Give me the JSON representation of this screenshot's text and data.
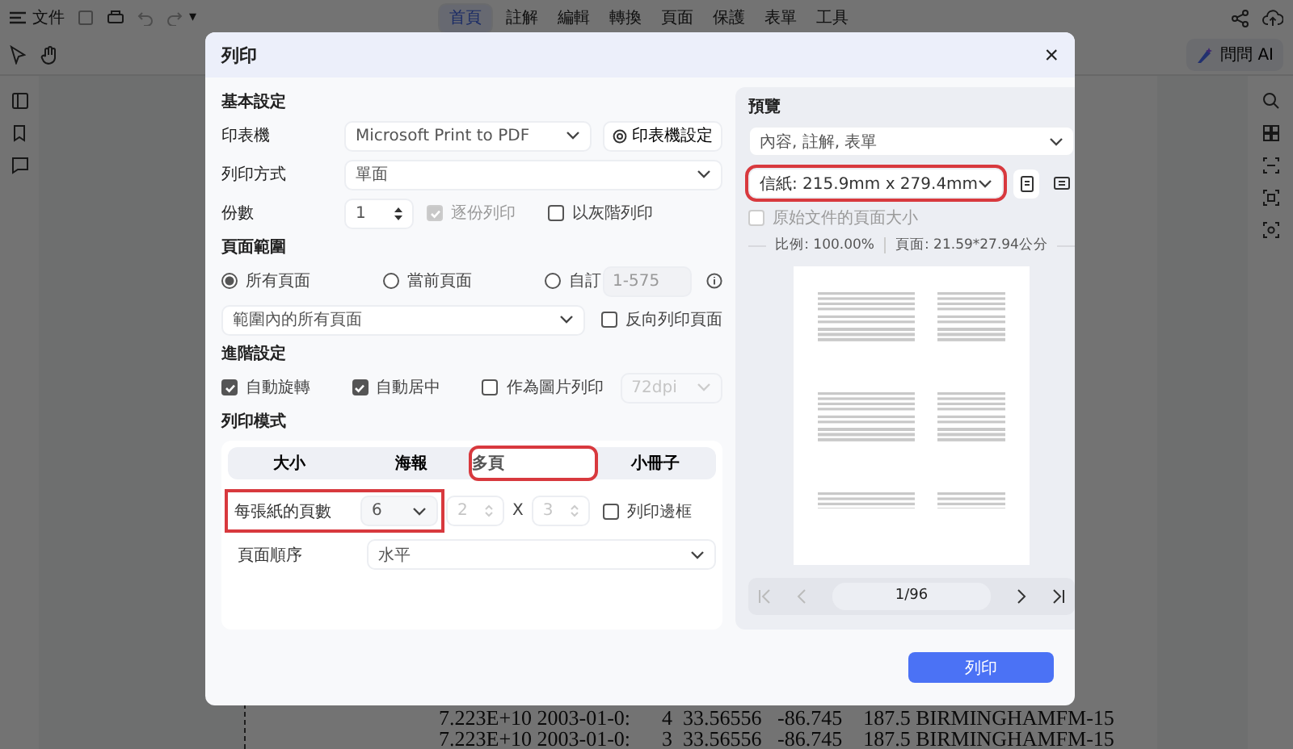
{
  "toolbar": {
    "file_menu": "文件",
    "more": "▾",
    "tabs": [
      {
        "label": "首頁",
        "selected": true
      },
      {
        "label": "註解",
        "selected": false
      },
      {
        "label": "編輯",
        "selected": false
      },
      {
        "label": "轉換",
        "selected": false
      },
      {
        "label": "頁面",
        "selected": false
      },
      {
        "label": "保護",
        "selected": false
      },
      {
        "label": "表單",
        "selected": false
      },
      {
        "label": "工具",
        "selected": false
      }
    ],
    "ask_ai": "問問 AI"
  },
  "document_lines": [
    "7.223E+10 2003-01-0:      4  33.56556   -86.745    187.5 BIRMINGHAMFM-15",
    "7.223E+10 2003-01-0:      3  33.56556   -86.745    187.5 BIRMINGHAMFM-15"
  ],
  "dialog": {
    "title": "列印",
    "close": "×",
    "basic": {
      "heading": "基本設定",
      "printer": {
        "label": "印表機",
        "value": "Microsoft Print to PDF",
        "settings_button": "印表機設定"
      },
      "mode": {
        "label": "列印方式",
        "value": "單面"
      },
      "copies": {
        "label": "份數",
        "value": "1"
      },
      "collate": {
        "label": "逐份列印",
        "checked": true,
        "disabled": true
      },
      "grayscale": {
        "label": "以灰階列印",
        "checked": false,
        "disabled": false
      }
    },
    "range": {
      "heading": "頁面範圍",
      "options": [
        {
          "label": "所有頁面",
          "selected": true
        },
        {
          "label": "當前頁面",
          "selected": false
        },
        {
          "label": "自訂",
          "selected": false
        }
      ],
      "custom_placeholder": "1-575",
      "subset": "範圍內的所有頁面",
      "reverse": {
        "label": "反向列印頁面",
        "checked": false,
        "disabled": false
      }
    },
    "advanced": {
      "heading": "進階設定",
      "options": [
        {
          "label": "自動旋轉",
          "checked": true,
          "disabled": false
        },
        {
          "label": "自動居中",
          "checked": true,
          "disabled": false
        },
        {
          "label": "作為圖片列印",
          "checked": false,
          "disabled": false
        }
      ],
      "dpi": "72dpi"
    },
    "print_mode": {
      "heading": "列印模式",
      "tabs": [
        {
          "label": "大小",
          "selected": false,
          "highlighted": false
        },
        {
          "label": "海報",
          "selected": false,
          "highlighted": false
        },
        {
          "label": "多頁",
          "selected": true,
          "highlighted": true
        },
        {
          "label": "小冊子",
          "selected": false,
          "highlighted": false
        }
      ],
      "pages_per_sheet": {
        "label": "每張紙的頁數",
        "value": "6",
        "highlighted": true
      },
      "columns": "2",
      "times": "X",
      "rows": "3",
      "border": {
        "label": "列印邊框",
        "checked": false,
        "disabled": false
      },
      "order": {
        "label": "頁面順序",
        "value": "水平"
      }
    },
    "preview": {
      "heading": "預覽",
      "content": "內容, 註解, 表單",
      "paper": {
        "value": "信紙: 215.9mm x 279.4mm",
        "highlighted": true
      },
      "original_size": {
        "label": "原始文件的頁面大小",
        "checked": false,
        "disabled": true
      },
      "scale": "比例: 100.00%",
      "page_size": "頁面: 21.59*27.94公分",
      "page": "1/96"
    },
    "print_button": "列印"
  }
}
